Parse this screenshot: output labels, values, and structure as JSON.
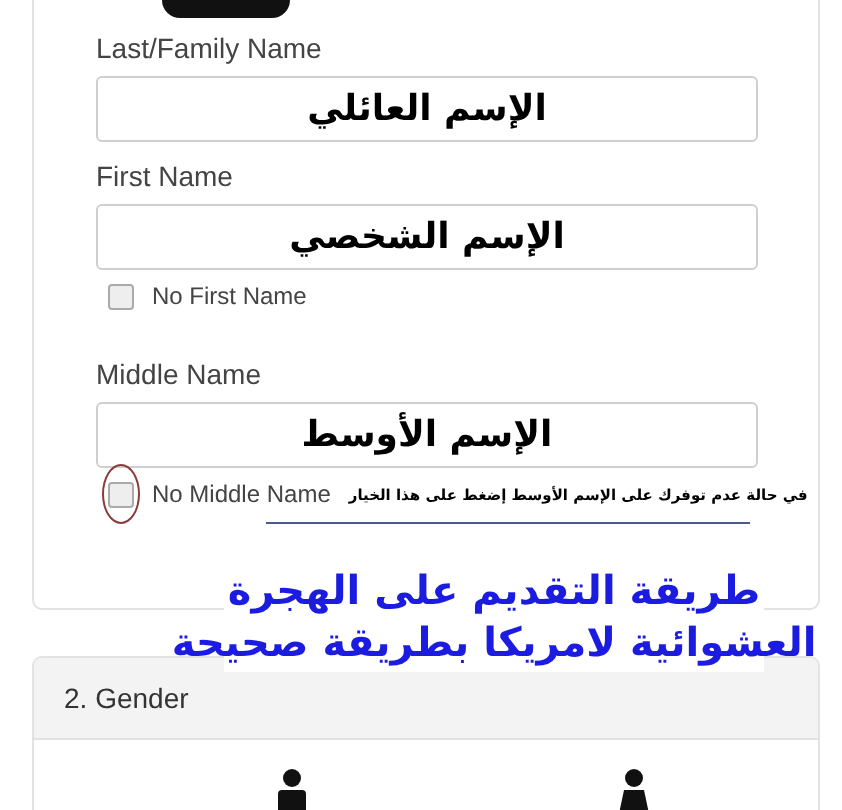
{
  "name_card": {
    "fields": [
      {
        "label": "Last/Family Name",
        "value": "الإسم العائلي"
      },
      {
        "label": "First Name",
        "value": "الإسم الشخصي",
        "checkbox": {
          "label": "No First Name",
          "checked": false,
          "circled": false
        }
      },
      {
        "label": "Middle Name",
        "value": "الإسم الأوسط",
        "checkbox": {
          "label": "No Middle Name",
          "checked": false,
          "circled": true,
          "note": "في حالة عدم توفرك على الإسم الأوسط إضغط على هذا الخيار"
        }
      }
    ]
  },
  "caption": {
    "lines": [
      "طريقة التقديم على الهجرة",
      "العشوائية لامريكا بطريقة صحيحة"
    ]
  },
  "gender_card": {
    "title": "2. Gender"
  }
}
